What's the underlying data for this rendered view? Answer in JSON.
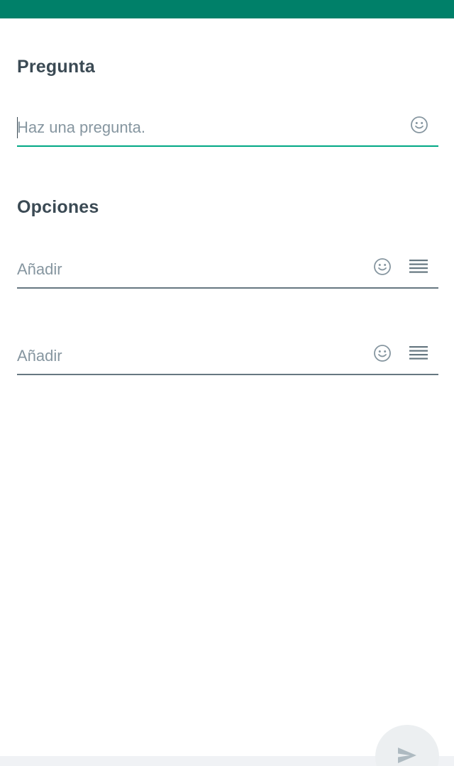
{
  "header": {
    "bar_color": "#008069"
  },
  "question": {
    "title": "Pregunta",
    "placeholder": "Haz una pregunta.",
    "value": "",
    "emoji_icon": "emoji-icon"
  },
  "options": {
    "title": "Opciones",
    "items": [
      {
        "placeholder": "Añadir",
        "value": "",
        "emoji_icon": "emoji-icon",
        "drag_icon": "drag-handle-icon"
      },
      {
        "placeholder": "Añadir",
        "value": "",
        "emoji_icon": "emoji-icon",
        "drag_icon": "drag-handle-icon"
      }
    ]
  },
  "footer": {
    "send_icon": "send-icon"
  },
  "colors": {
    "accent": "#00a884",
    "text": "#3b4a54",
    "placeholder": "#8696a0",
    "underline": "#667781"
  }
}
